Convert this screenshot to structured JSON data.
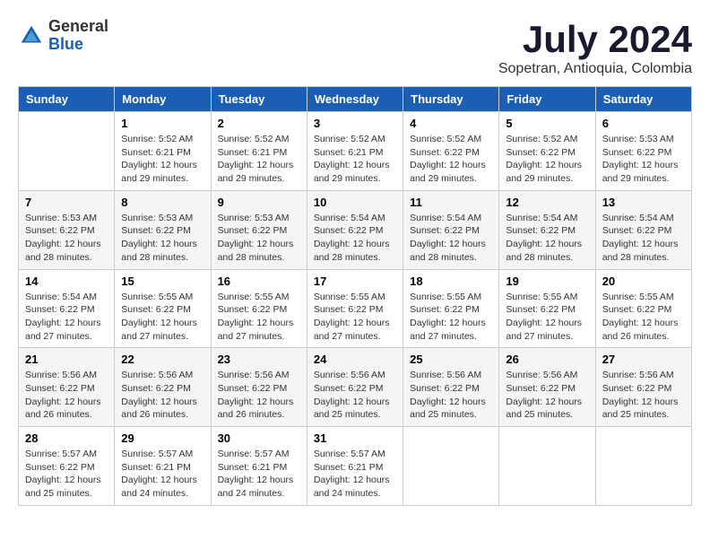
{
  "logo": {
    "general": "General",
    "blue": "Blue"
  },
  "title": "July 2024",
  "subtitle": "Sopetran, Antioquia, Colombia",
  "days_of_week": [
    "Sunday",
    "Monday",
    "Tuesday",
    "Wednesday",
    "Thursday",
    "Friday",
    "Saturday"
  ],
  "weeks": [
    [
      {
        "day": "",
        "info": ""
      },
      {
        "day": "1",
        "info": "Sunrise: 5:52 AM\nSunset: 6:21 PM\nDaylight: 12 hours\nand 29 minutes."
      },
      {
        "day": "2",
        "info": "Sunrise: 5:52 AM\nSunset: 6:21 PM\nDaylight: 12 hours\nand 29 minutes."
      },
      {
        "day": "3",
        "info": "Sunrise: 5:52 AM\nSunset: 6:21 PM\nDaylight: 12 hours\nand 29 minutes."
      },
      {
        "day": "4",
        "info": "Sunrise: 5:52 AM\nSunset: 6:22 PM\nDaylight: 12 hours\nand 29 minutes."
      },
      {
        "day": "5",
        "info": "Sunrise: 5:52 AM\nSunset: 6:22 PM\nDaylight: 12 hours\nand 29 minutes."
      },
      {
        "day": "6",
        "info": "Sunrise: 5:53 AM\nSunset: 6:22 PM\nDaylight: 12 hours\nand 29 minutes."
      }
    ],
    [
      {
        "day": "7",
        "info": "Sunrise: 5:53 AM\nSunset: 6:22 PM\nDaylight: 12 hours\nand 28 minutes."
      },
      {
        "day": "8",
        "info": "Sunrise: 5:53 AM\nSunset: 6:22 PM\nDaylight: 12 hours\nand 28 minutes."
      },
      {
        "day": "9",
        "info": "Sunrise: 5:53 AM\nSunset: 6:22 PM\nDaylight: 12 hours\nand 28 minutes."
      },
      {
        "day": "10",
        "info": "Sunrise: 5:54 AM\nSunset: 6:22 PM\nDaylight: 12 hours\nand 28 minutes."
      },
      {
        "day": "11",
        "info": "Sunrise: 5:54 AM\nSunset: 6:22 PM\nDaylight: 12 hours\nand 28 minutes."
      },
      {
        "day": "12",
        "info": "Sunrise: 5:54 AM\nSunset: 6:22 PM\nDaylight: 12 hours\nand 28 minutes."
      },
      {
        "day": "13",
        "info": "Sunrise: 5:54 AM\nSunset: 6:22 PM\nDaylight: 12 hours\nand 28 minutes."
      }
    ],
    [
      {
        "day": "14",
        "info": "Sunrise: 5:54 AM\nSunset: 6:22 PM\nDaylight: 12 hours\nand 27 minutes."
      },
      {
        "day": "15",
        "info": "Sunrise: 5:55 AM\nSunset: 6:22 PM\nDaylight: 12 hours\nand 27 minutes."
      },
      {
        "day": "16",
        "info": "Sunrise: 5:55 AM\nSunset: 6:22 PM\nDaylight: 12 hours\nand 27 minutes."
      },
      {
        "day": "17",
        "info": "Sunrise: 5:55 AM\nSunset: 6:22 PM\nDaylight: 12 hours\nand 27 minutes."
      },
      {
        "day": "18",
        "info": "Sunrise: 5:55 AM\nSunset: 6:22 PM\nDaylight: 12 hours\nand 27 minutes."
      },
      {
        "day": "19",
        "info": "Sunrise: 5:55 AM\nSunset: 6:22 PM\nDaylight: 12 hours\nand 27 minutes."
      },
      {
        "day": "20",
        "info": "Sunrise: 5:55 AM\nSunset: 6:22 PM\nDaylight: 12 hours\nand 26 minutes."
      }
    ],
    [
      {
        "day": "21",
        "info": "Sunrise: 5:56 AM\nSunset: 6:22 PM\nDaylight: 12 hours\nand 26 minutes."
      },
      {
        "day": "22",
        "info": "Sunrise: 5:56 AM\nSunset: 6:22 PM\nDaylight: 12 hours\nand 26 minutes."
      },
      {
        "day": "23",
        "info": "Sunrise: 5:56 AM\nSunset: 6:22 PM\nDaylight: 12 hours\nand 26 minutes."
      },
      {
        "day": "24",
        "info": "Sunrise: 5:56 AM\nSunset: 6:22 PM\nDaylight: 12 hours\nand 25 minutes."
      },
      {
        "day": "25",
        "info": "Sunrise: 5:56 AM\nSunset: 6:22 PM\nDaylight: 12 hours\nand 25 minutes."
      },
      {
        "day": "26",
        "info": "Sunrise: 5:56 AM\nSunset: 6:22 PM\nDaylight: 12 hours\nand 25 minutes."
      },
      {
        "day": "27",
        "info": "Sunrise: 5:56 AM\nSunset: 6:22 PM\nDaylight: 12 hours\nand 25 minutes."
      }
    ],
    [
      {
        "day": "28",
        "info": "Sunrise: 5:57 AM\nSunset: 6:22 PM\nDaylight: 12 hours\nand 25 minutes."
      },
      {
        "day": "29",
        "info": "Sunrise: 5:57 AM\nSunset: 6:21 PM\nDaylight: 12 hours\nand 24 minutes."
      },
      {
        "day": "30",
        "info": "Sunrise: 5:57 AM\nSunset: 6:21 PM\nDaylight: 12 hours\nand 24 minutes."
      },
      {
        "day": "31",
        "info": "Sunrise: 5:57 AM\nSunset: 6:21 PM\nDaylight: 12 hours\nand 24 minutes."
      },
      {
        "day": "",
        "info": ""
      },
      {
        "day": "",
        "info": ""
      },
      {
        "day": "",
        "info": ""
      }
    ]
  ]
}
